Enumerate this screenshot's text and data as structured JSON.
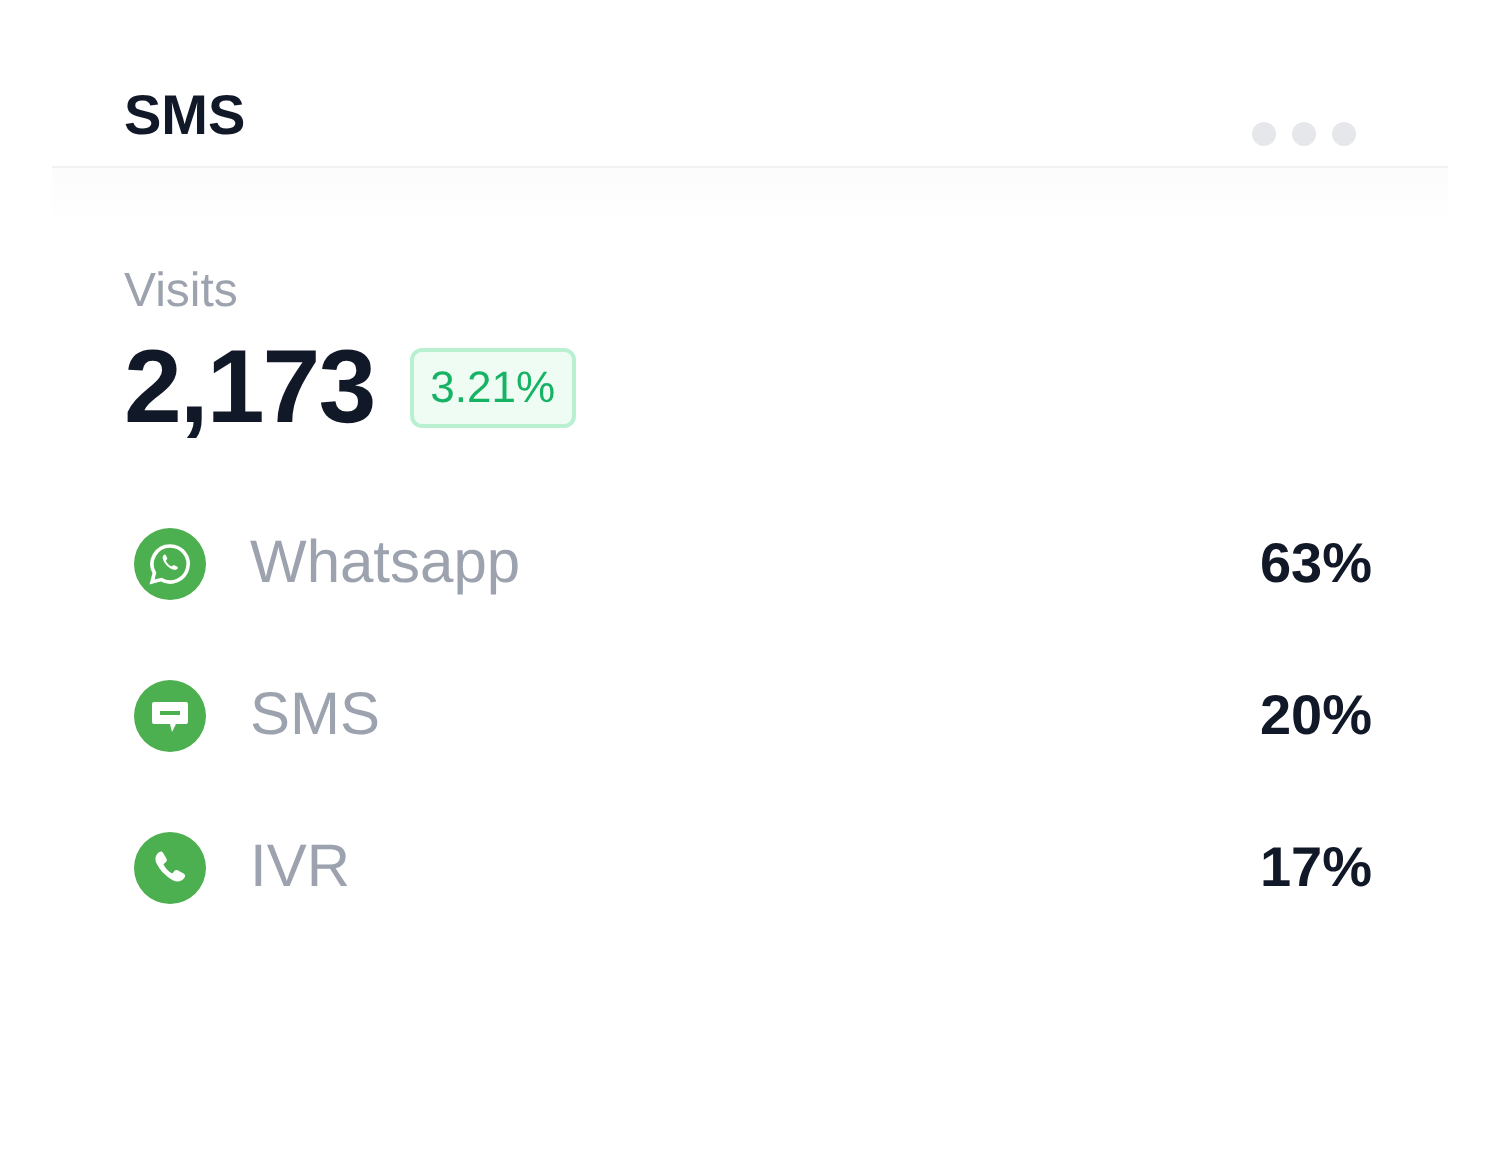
{
  "card": {
    "title": "SMS"
  },
  "stats": {
    "label": "Visits",
    "value": "2,173",
    "change": "3.21%"
  },
  "channels": [
    {
      "kind": "whatsapp",
      "name": "Whatsapp",
      "share": "63%"
    },
    {
      "kind": "sms",
      "name": "SMS",
      "share": "20%"
    },
    {
      "kind": "phone",
      "name": "IVR",
      "share": "17%"
    }
  ]
}
